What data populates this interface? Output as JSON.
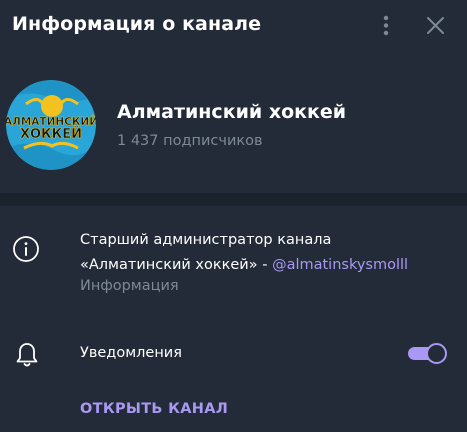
{
  "header": {
    "title": "Информация о канале",
    "more_icon": "more-vertical-icon",
    "close_icon": "close-icon"
  },
  "profile": {
    "avatar_text_line1": "АЛМАТИНСКИЙ",
    "avatar_text_line2": "ХОККЕЙ",
    "name": "Алматинский хоккей",
    "subscribers": "1 437 подписчиков"
  },
  "info": {
    "icon": "info-icon",
    "text_line1": "Старший администратор канала",
    "text_line2_prefix": "«Алматинский хоккей» - ",
    "link": "@almatinskysmolll",
    "caption": "Информация"
  },
  "notifications": {
    "icon": "bell-icon",
    "label": "Уведомления",
    "enabled": true
  },
  "open_channel": {
    "label": "ОТКРЫТЬ КАНАЛ"
  },
  "colors": {
    "background": "#222b37",
    "divider": "#1a222c",
    "accent": "#a998f4",
    "secondary_text": "#7e8997",
    "avatar_sky": "#2aa5d8",
    "avatar_gold": "#f3c21e",
    "avatar_text": "#111111"
  }
}
